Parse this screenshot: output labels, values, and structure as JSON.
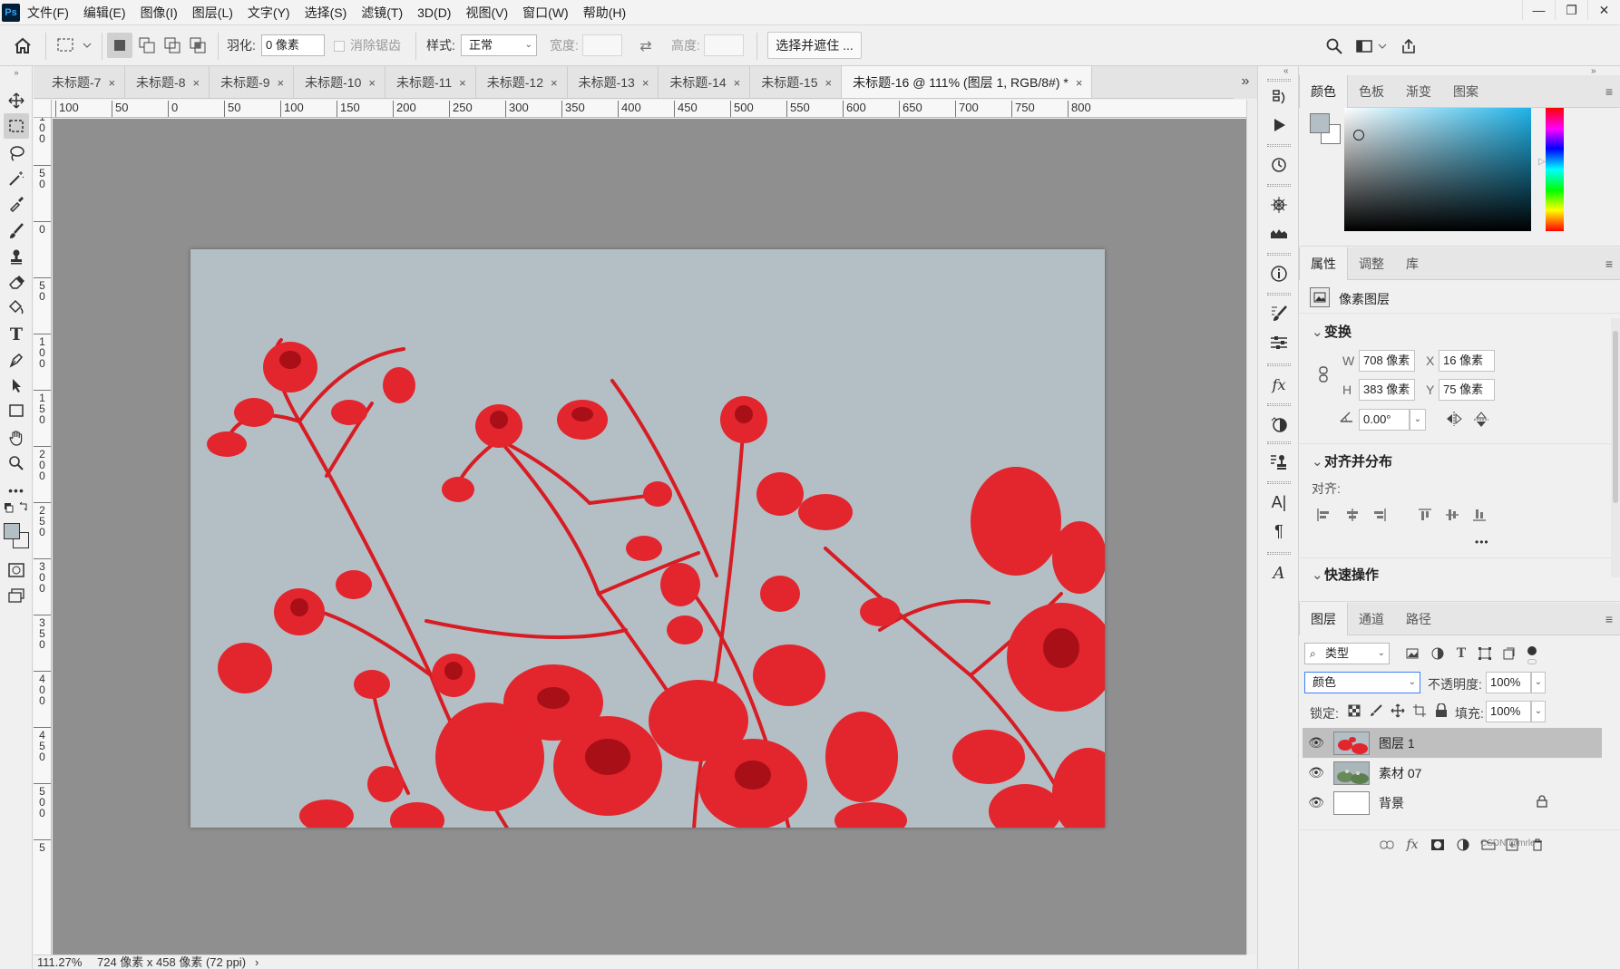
{
  "app": {
    "logo": "Ps",
    "menu": [
      "文件(F)",
      "编辑(E)",
      "图像(I)",
      "图层(L)",
      "文字(Y)",
      "选择(S)",
      "滤镜(T)",
      "3D(D)",
      "视图(V)",
      "窗口(W)",
      "帮助(H)"
    ],
    "window_controls": [
      "—",
      "❐",
      "✕"
    ]
  },
  "options": {
    "feather_label": "羽化:",
    "feather_value": "0 像素",
    "antialias_label": "消除锯齿",
    "style_label": "样式:",
    "style_value": "正常",
    "width_label": "宽度:",
    "height_label": "高度:",
    "select_mask_button": "选择并遮住 ..."
  },
  "tabs": [
    {
      "label": "未标题-7",
      "close": "×"
    },
    {
      "label": "未标题-8",
      "close": "×"
    },
    {
      "label": "未标题-9",
      "close": "×"
    },
    {
      "label": "未标题-10",
      "close": "×"
    },
    {
      "label": "未标题-11",
      "close": "×"
    },
    {
      "label": "未标题-12",
      "close": "×"
    },
    {
      "label": "未标题-13",
      "close": "×"
    },
    {
      "label": "未标题-14",
      "close": "×"
    },
    {
      "label": "未标题-15",
      "close": "×"
    },
    {
      "label": "未标题-16 @ 111% (图层 1, RGB/8#) *",
      "close": "×"
    }
  ],
  "tabs_overflow": "»",
  "ruler_top": [
    "100",
    "50",
    "0",
    "50",
    "100",
    "150",
    "200",
    "250",
    "300",
    "350",
    "400",
    "450",
    "500",
    "550",
    "600",
    "650",
    "700",
    "750",
    "800"
  ],
  "ruler_left": [
    "1\n0\n0",
    "5\n0",
    "0",
    "5\n0",
    "1\n0\n0",
    "1\n5\n0",
    "2\n0\n0",
    "2\n5\n0",
    "3\n0\n0",
    "3\n5\n0",
    "4\n0\n0",
    "4\n5\n0",
    "5\n0\n0",
    "5"
  ],
  "status": {
    "zoom": "111.27%",
    "doc_size": "724 像素 x 458 像素 (72 ppi)",
    "arrow": "›"
  },
  "color_panel": {
    "tabs": [
      "颜色",
      "色板",
      "渐变",
      "图案"
    ],
    "foreground": "#b3bfc4",
    "background": "#ffffff",
    "field_hue": "#1fb3e8"
  },
  "properties_panel": {
    "tabs": [
      "属性",
      "调整",
      "库"
    ],
    "layer_type": "像素图层",
    "transform_title": "变换",
    "w_label": "W",
    "w_value": "708 像素",
    "h_label": "H",
    "h_value": "383 像素",
    "x_label": "X",
    "x_value": "16 像素",
    "y_label": "Y",
    "y_value": "75 像素",
    "angle_value": "0.00°",
    "align_title": "对齐并分布",
    "align_label": "对齐:",
    "more": "•••",
    "quick_title": "快速操作"
  },
  "layers_panel": {
    "tabs": [
      "图层",
      "通道",
      "路径"
    ],
    "filter_value": "类型",
    "blend_mode": "颜色",
    "opacity_label": "不透明度:",
    "opacity_value": "100%",
    "lock_label": "锁定:",
    "fill_label": "填充:",
    "fill_value": "100%",
    "layers": [
      {
        "name": "图层 1",
        "selected": true
      },
      {
        "name": "素材 07",
        "selected": false
      },
      {
        "name": "背景",
        "selected": false
      }
    ],
    "watermark": "CSDN @mrle"
  }
}
